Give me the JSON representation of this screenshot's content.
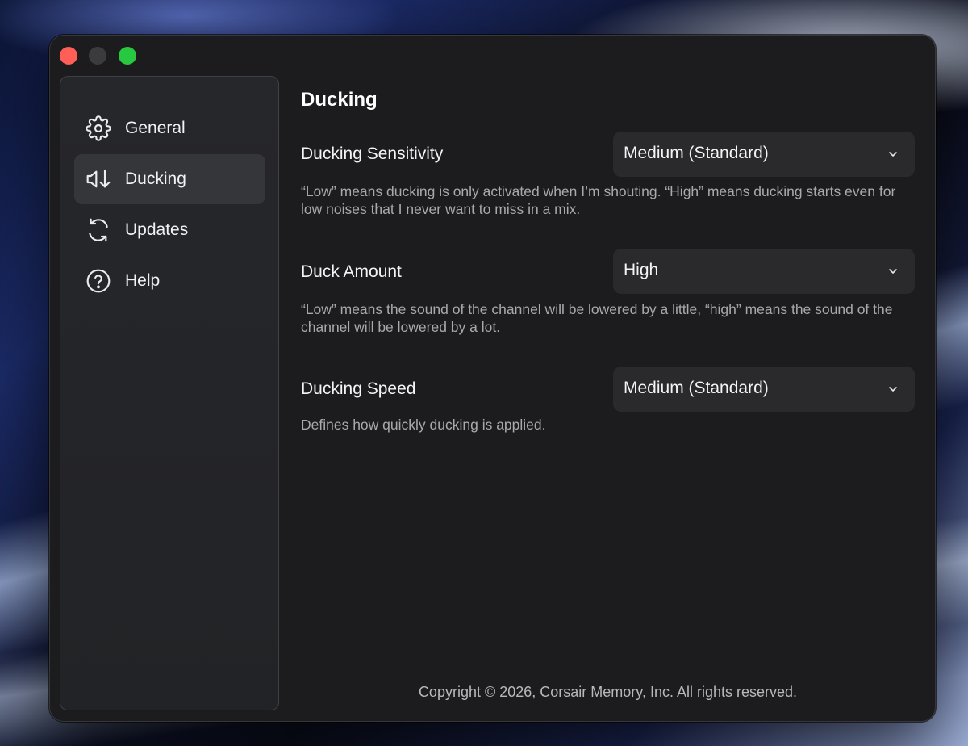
{
  "window": {
    "controls": {
      "close_color": "#ff5f57",
      "minimize_color": "#3b3b3d",
      "zoom_color": "#28c840"
    }
  },
  "sidebar": {
    "items": [
      {
        "label": "General",
        "icon": "gear-icon",
        "active": false
      },
      {
        "label": "Ducking",
        "icon": "speaker-duck-icon",
        "active": true
      },
      {
        "label": "Updates",
        "icon": "refresh-icon",
        "active": false
      },
      {
        "label": "Help",
        "icon": "help-circle-icon",
        "active": false
      }
    ]
  },
  "main": {
    "title": "Ducking",
    "settings": [
      {
        "label": "Ducking Sensitivity",
        "value": "Medium (Standard)",
        "description": "“Low” means ducking is only activated when I’m shouting. “High” means ducking starts even for low noises that I never want to miss in a mix."
      },
      {
        "label": "Duck Amount",
        "value": "High",
        "description": "“Low” means the sound of the channel will be lowered by a little, “high” means the sound of the channel will be lowered by a lot."
      },
      {
        "label": "Ducking Speed",
        "value": "Medium (Standard)",
        "description": "Defines how quickly ducking is applied."
      }
    ]
  },
  "footer": {
    "copyright": "Copyright © 2026, Corsair Memory, Inc. All rights reserved."
  },
  "colors": {
    "window_bg": "#1c1c1e",
    "sidebar_active_bg": "#35363a",
    "select_bg": "#2a2a2d"
  }
}
